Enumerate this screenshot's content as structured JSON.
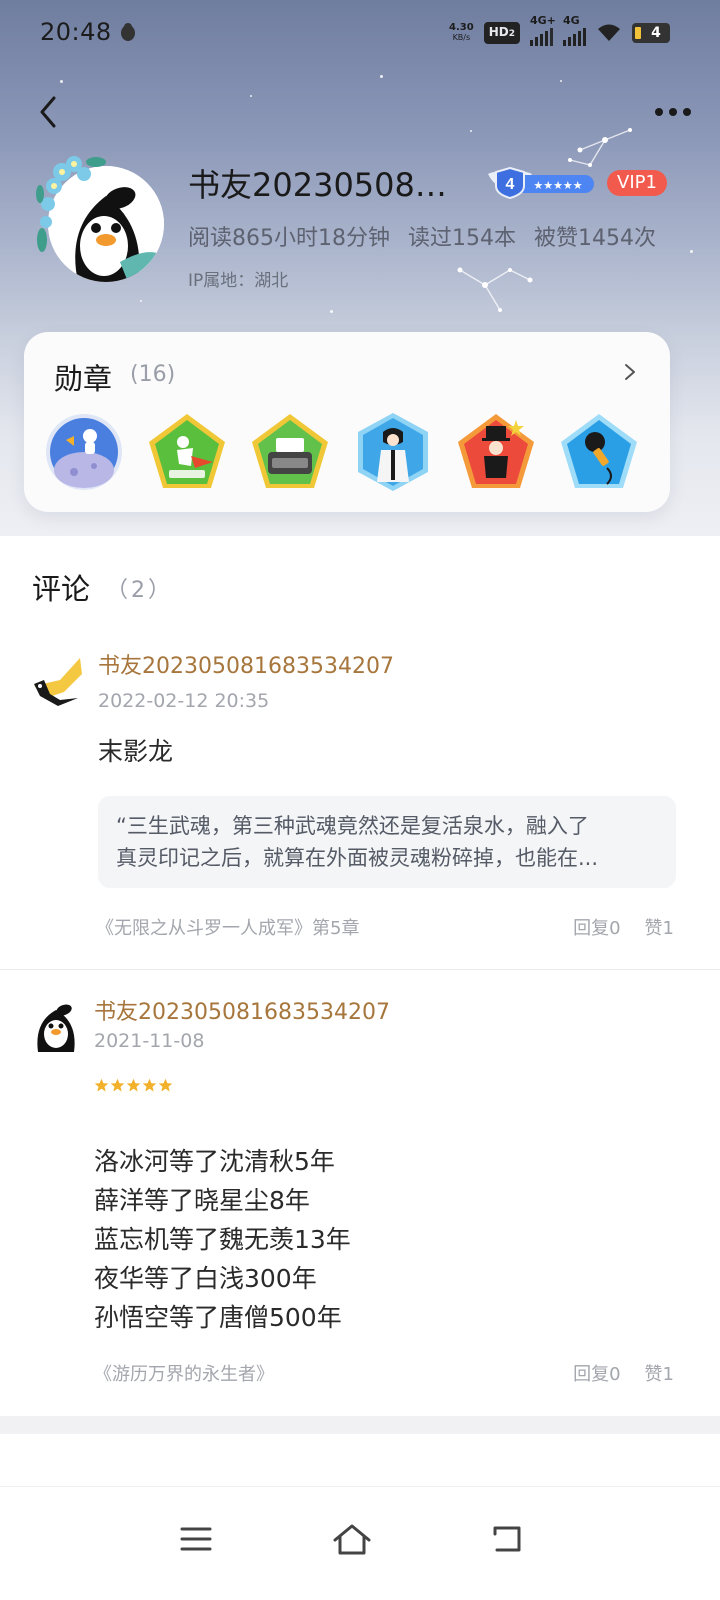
{
  "status_bar": {
    "time": "20:48",
    "net_speed_value": "4.30",
    "net_speed_unit": "KB/s",
    "hd_label": "HD",
    "hd_sub": "2",
    "signal1_label": "4G+",
    "signal2_label": "4G",
    "battery_level": "4"
  },
  "profile": {
    "name": "书友202305081…",
    "level": "4",
    "vip_label": "VIP1",
    "reading_time": "阅读865小时18分钟",
    "books_read": "读过154本",
    "likes_received": "被赞1454次",
    "ip_location": "IP属地：湖北"
  },
  "medals": {
    "title": "勋章",
    "count": "(16)",
    "items": [
      {
        "icon": "astronaut-moon-medal-icon"
      },
      {
        "icon": "flying-hero-book-medal-icon"
      },
      {
        "icon": "typewriter-medal-icon"
      },
      {
        "icon": "ancient-scholar-medal-icon"
      },
      {
        "icon": "magician-medal-icon"
      },
      {
        "icon": "microphone-medal-icon"
      }
    ]
  },
  "comments": {
    "title": "评论",
    "count": "（2）",
    "items": [
      {
        "user": "书友202305081683534207",
        "date": "2022-02-12 20:35",
        "text": "末影龙",
        "quote_line1": "“三生武魂，第三种武魂竟然还是复活泉水，融入了",
        "quote_line2": "真灵印记之后，就算在外面被灵魂粉碎掉，也能在...",
        "book": "《无限之从斗罗一人成军》第5章",
        "replies": "回复0",
        "likes": "赞1"
      },
      {
        "user": "书友202305081683534207",
        "date": "2021-11-08",
        "rating": 5,
        "lines": [
          "洛冰河等了沈清秋5年",
          "薛洋等了晓星尘8年",
          "蓝忘机等了魏无羡13年",
          "夜华等了白浅300年",
          "孙悟空等了唐僧500年"
        ],
        "book": "《游历万界的永生者》",
        "replies": "回复0",
        "likes": "赞1"
      }
    ]
  },
  "colors": {
    "username": "#a7763c",
    "vip": "#f25a4e",
    "star": "#f3b02a"
  }
}
